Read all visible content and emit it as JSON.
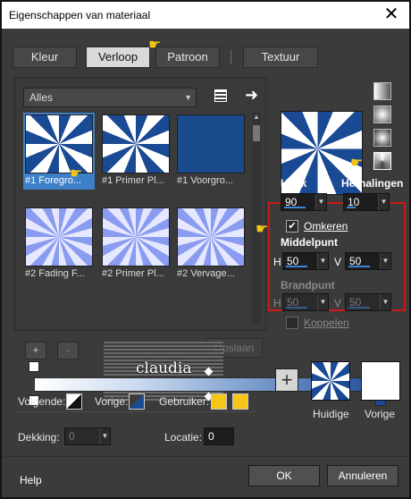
{
  "window": {
    "title": "Eigenschappen van materiaal"
  },
  "tabs": [
    {
      "label": "Kleur",
      "active": false
    },
    {
      "label": "Verloop",
      "active": true
    },
    {
      "label": "Patroon",
      "active": false
    },
    {
      "label": "Textuur",
      "active": false
    }
  ],
  "library": {
    "selected": "Alles"
  },
  "gradients": [
    {
      "caption": "#1 Foregro...",
      "style": "radial",
      "selected": true
    },
    {
      "caption": "#1 Primer Pl...",
      "style": "radial",
      "selected": false
    },
    {
      "caption": "#1 Voorgro...",
      "style": "solid",
      "selected": false
    },
    {
      "caption": "#2 Fading F...",
      "style": "fade",
      "selected": false
    },
    {
      "caption": "#2 Primer Pl...",
      "style": "fade",
      "selected": false
    },
    {
      "caption": "#2 Vervage...",
      "style": "fade",
      "selected": false
    }
  ],
  "editor": {
    "add_label": "+",
    "remove_label": "-",
    "save_label": "Opslaan"
  },
  "watermark": {
    "text": "claudia"
  },
  "params": {
    "hoek_label": "Hoek",
    "hoek": "90",
    "herhalingen_label": "Herhalingen",
    "herhalingen": "10",
    "omkeren_label": "Omkeren",
    "omkeren_checked": true,
    "middelpunt_label": "Middelpunt",
    "h_label": "H",
    "h_value": "50",
    "v_label": "V",
    "v_value": "50",
    "brandpunt_label": "Brandpunt",
    "bh_value": "50",
    "bv_value": "50",
    "koppelen_label": "Koppelen"
  },
  "colors": {
    "volgende_label": "Volgende:",
    "vorige_label": "Vorige:",
    "gebruiker_label": "Gebruiker:",
    "user_color": "#f5c518",
    "accent": "#3e80c7",
    "gradient_dark": "#1b4a94"
  },
  "opacity": {
    "label": "Dekking:",
    "value": "0"
  },
  "location": {
    "label": "Locatie:",
    "value": "0"
  },
  "previews": {
    "current": "Huidige",
    "previous": "Vorige"
  },
  "footer": {
    "help": "Help",
    "ok": "OK",
    "cancel": "Annuleren"
  }
}
